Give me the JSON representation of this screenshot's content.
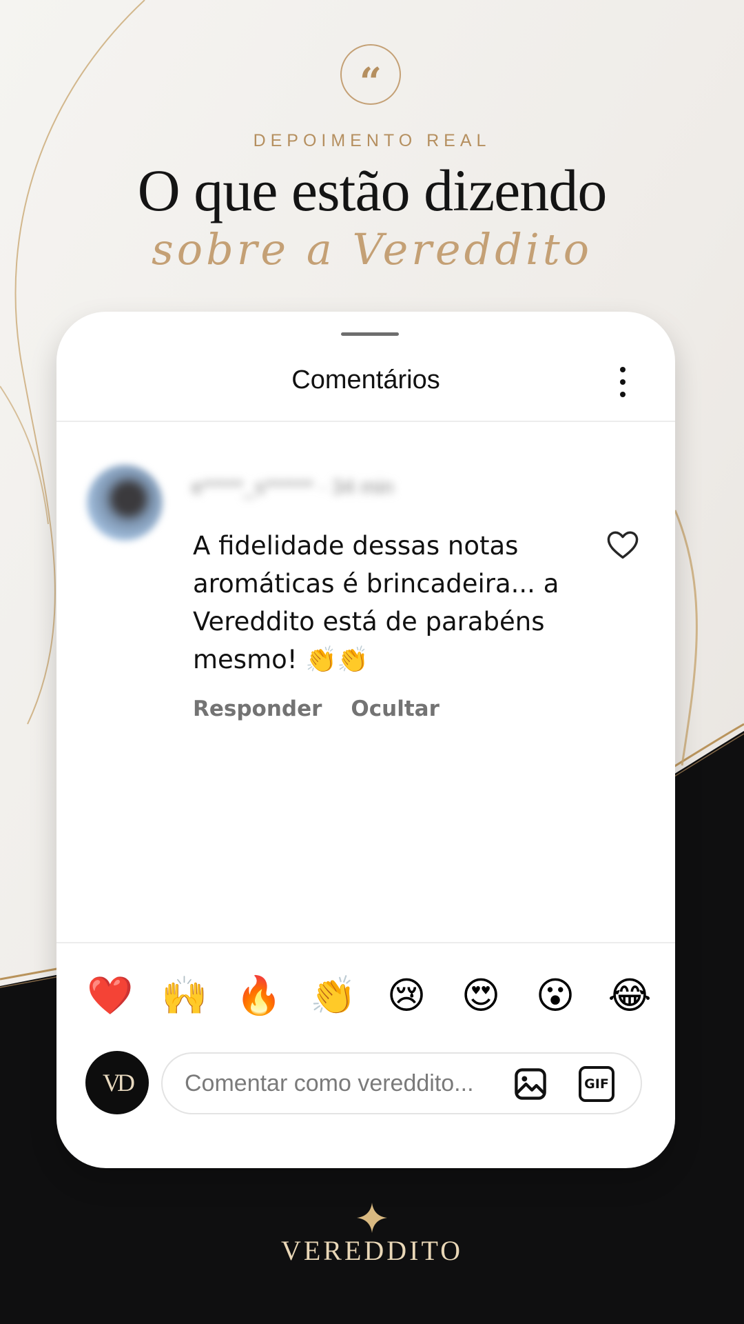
{
  "hero": {
    "eyebrow": "DEPOIMENTO REAL",
    "headline": "O que estão dizendo",
    "script_line": "sobre a Vereddito",
    "quote_glyph": "“"
  },
  "panel": {
    "title": "Comentários",
    "menu_icon": "more-vertical-icon"
  },
  "comment": {
    "username": "e*****_s****** · 34 min",
    "text": "A fidelidade dessas notas aromáticas é brincadeira... a Vereddito está de parabéns mesmo! 👏👏",
    "reply_label": "Responder",
    "hide_label": "Ocultar",
    "like_icon": "heart-outline-icon"
  },
  "reactions": [
    "❤️",
    "🙌",
    "🔥",
    "👏",
    "😢",
    "😍",
    "😮",
    "😂"
  ],
  "composer": {
    "avatar_initials": "VD",
    "placeholder": "Comentar como vereddito...",
    "image_icon": "image-icon",
    "gif_label": "GIF"
  },
  "footer": {
    "brand": "VEREDDITO"
  },
  "colors": {
    "gold": "#c4a075",
    "dark": "#0f0f10",
    "cream": "#f3f1ee"
  }
}
